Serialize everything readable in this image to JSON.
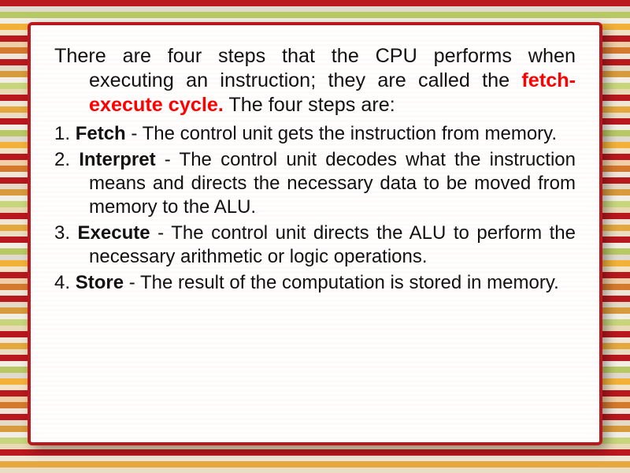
{
  "intro": {
    "lead": "There are four steps that the CPU performs when executing an instruction; they are called the ",
    "highlight": "fetch-execute cycle.",
    "tail": " The four steps are:"
  },
  "items": [
    {
      "num": "1.",
      "term": "Fetch",
      "sep": " - ",
      "desc": "The control unit gets the instruction from memory."
    },
    {
      "num": "2.",
      "term": "Interpret",
      "sep": " - ",
      "desc": "The control unit decodes what the instruction means and directs the necessary data to be moved from memory to the ALU."
    },
    {
      "num": "3.",
      "term": "Execute",
      "sep": " - ",
      "desc": "The control unit directs the ALU to perform the necessary arithmetic or logic operations."
    },
    {
      "num": "4.",
      "term": "Store",
      "sep": " - ",
      "desc": "The result of the computation is stored in memory."
    }
  ],
  "colors": {
    "stripes": [
      "#b8181e",
      "#e0d9cf",
      "#b8c963",
      "#f2eee6",
      "#f2b23a",
      "#f1e3c4",
      "#b8181e",
      "#f0cfa6",
      "#d47a2e",
      "#f0e6d8",
      "#b8181e",
      "#e5dac5",
      "#d79a3c",
      "#f2eee6",
      "#c7d67b",
      "#ead9b6",
      "#b8181e",
      "#f0e6d8",
      "#e4a83e",
      "#eaddc3",
      "#b8181e",
      "#f2eee6",
      "#b8c963",
      "#e0d9cf",
      "#f2b23a",
      "#f1e3c4",
      "#b8181e",
      "#f0cfa6",
      "#d47a2e",
      "#f0e6d8",
      "#b8181e",
      "#e5dac5",
      "#d79a3c",
      "#f2eee6",
      "#c7d67b",
      "#ead9b6",
      "#b8181e",
      "#f0e6d8",
      "#e4a83e",
      "#eaddc3",
      "#b8181e",
      "#f2eee6",
      "#b8c963",
      "#e0d9cf",
      "#f2b23a",
      "#f1e3c4",
      "#b8181e",
      "#f0cfa6",
      "#d47a2e",
      "#f0e6d8",
      "#b8181e",
      "#e5dac5",
      "#d79a3c",
      "#f2eee6",
      "#c7d67b",
      "#ead9b6",
      "#b8181e",
      "#f0e6d8",
      "#e4a83e",
      "#eaddc3",
      "#b8181e",
      "#f2eee6",
      "#b8c963",
      "#e0d9cf",
      "#f2b23a",
      "#f1e3c4",
      "#b8181e",
      "#f0cfa6",
      "#d47a2e",
      "#f0e6d8",
      "#b8181e",
      "#e5dac5",
      "#d79a3c",
      "#f2eee6",
      "#c7d67b",
      "#ead9b6",
      "#b8181e",
      "#f0e6d8",
      "#e4a83e",
      "#eaddc3"
    ]
  }
}
